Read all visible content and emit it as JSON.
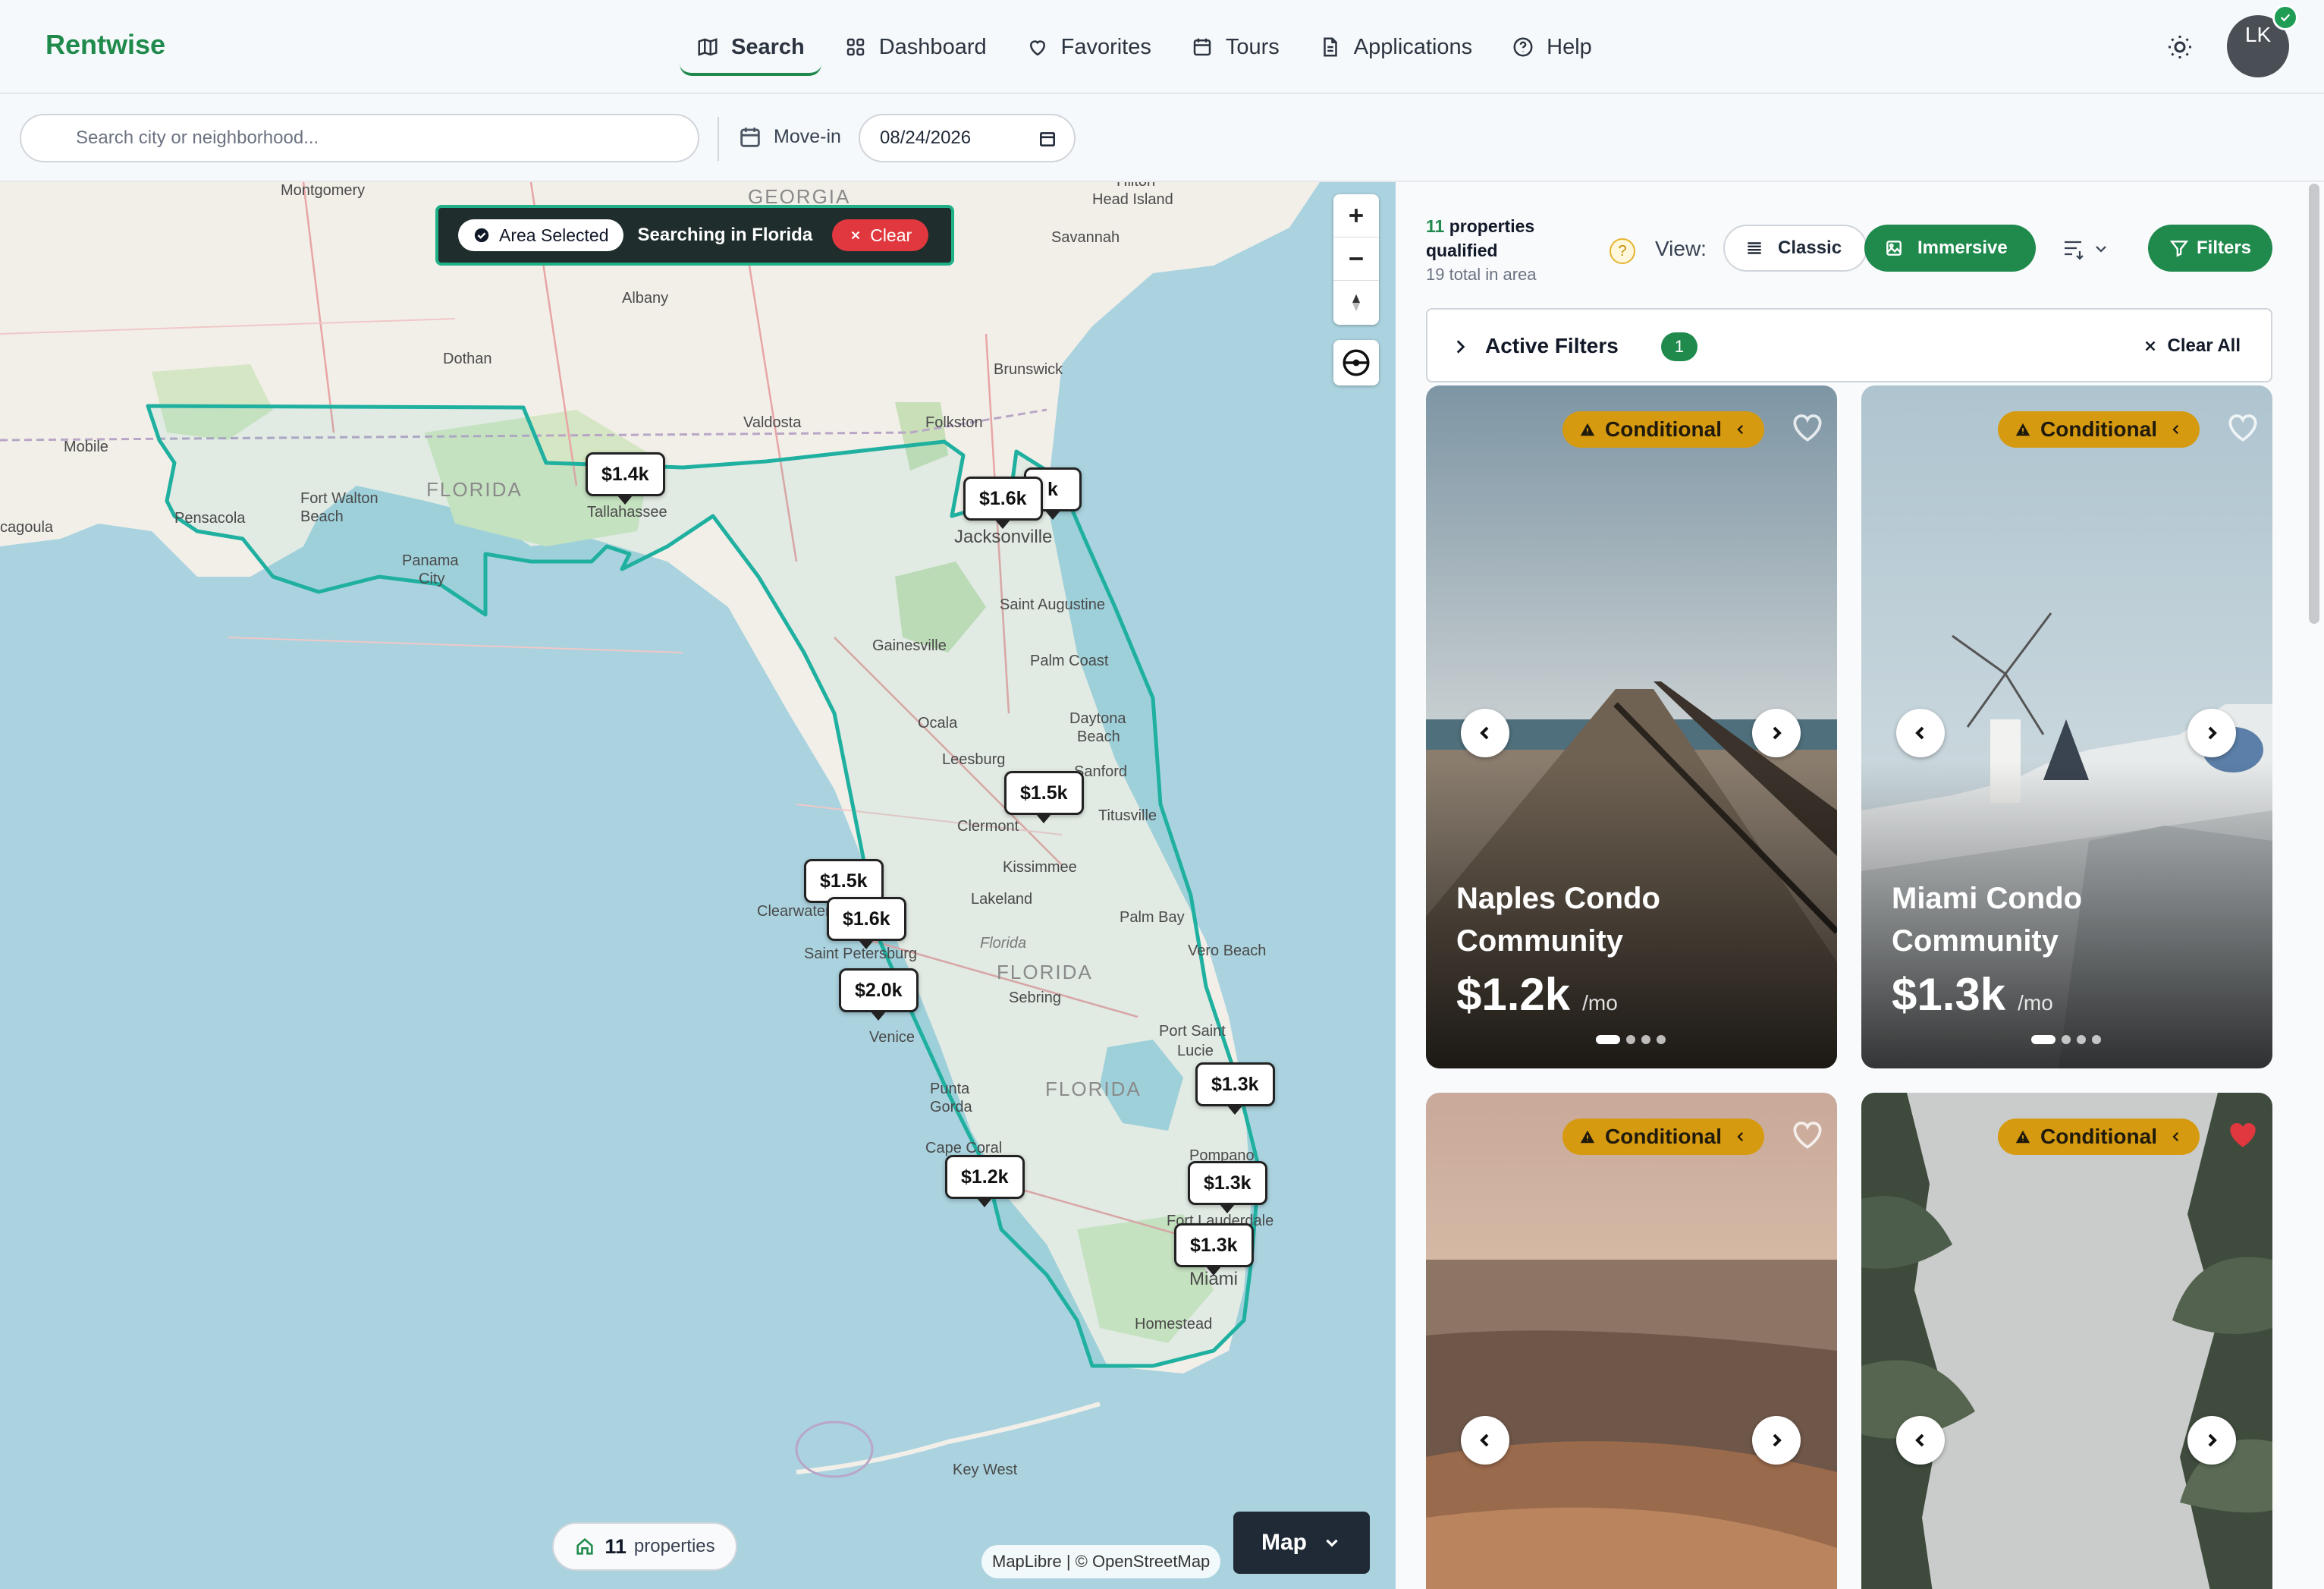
{
  "brand": "Rentwise",
  "nav": {
    "items": [
      {
        "label": "Search",
        "icon": "map-icon",
        "active": true
      },
      {
        "label": "Dashboard",
        "icon": "grid-icon"
      },
      {
        "label": "Favorites",
        "icon": "heart-icon"
      },
      {
        "label": "Tours",
        "icon": "calendar-icon"
      },
      {
        "label": "Applications",
        "icon": "document-icon"
      },
      {
        "label": "Help",
        "icon": "help-circle-icon"
      }
    ]
  },
  "user": {
    "initials": "LK",
    "verified": true
  },
  "search": {
    "placeholder": "Search city or neighborhood...",
    "movein_label": "Move-in",
    "movein_value": "08/24/2026"
  },
  "map": {
    "banner": {
      "chip": "Area Selected",
      "text": "Searching in Florida",
      "clear": "Clear"
    },
    "places": {
      "montgomery": "Montgomery",
      "georgia": "GEORGIA",
      "hilton": "Hilton",
      "head_island": "Head Island",
      "savannah": "Savannah",
      "albany": "Albany",
      "dothan": "Dothan",
      "brunswick": "Brunswick",
      "valdosta": "Valdosta",
      "folkston": "Folkston",
      "mobile": "Mobile",
      "fort_walton": "Fort Walton",
      "beach": "Beach",
      "florida_nw": "FLORIDA",
      "tallahassee": "Tallahassee",
      "jacksonville": "Jacksonville",
      "cagoula": "cagoula",
      "pensacola": "Pensacola",
      "panama": "Panama",
      "city": "City",
      "saint_augustine": "Saint Augustine",
      "gainesville": "Gainesville",
      "palm_coast": "Palm Coast",
      "ocala": "Ocala",
      "daytona": "Daytona",
      "beach2": "Beach",
      "leesburg": "Leesburg",
      "sanford": "Sanford",
      "titusville": "Titusville",
      "clermont": "Clermont",
      "kissimmee": "Kissimmee",
      "clearwater": "Clearwater",
      "lakeland": "Lakeland",
      "palm_bay": "Palm Bay",
      "saint_petersburg": "Saint Petersburg",
      "florida_it": "Florida",
      "florida_c": "FLORIDA",
      "vero_beach": "Vero Beach",
      "sebring": "Sebring",
      "venice": "Venice",
      "port_saint": "Port Saint",
      "lucie": "Lucie",
      "punta": "Punta",
      "gorda": "Gorda",
      "florida_s": "FLORIDA",
      "cape_coral": "Cape Coral",
      "pompano": "Pompano",
      "lauderdale": "Fort Lauderdale",
      "miami": "Miami",
      "homestead": "Homestead",
      "key_west": "Key West"
    },
    "pins": [
      {
        "label": "$1.4k"
      },
      {
        "label": "k"
      },
      {
        "label": "$1.6k"
      },
      {
        "label": "$1.5k"
      },
      {
        "label": "$1.5k"
      },
      {
        "label": "$1.6k"
      },
      {
        "label": "$2.0k"
      },
      {
        "label": "$1.3k"
      },
      {
        "label": "$1.2k"
      },
      {
        "label": "$1.3k"
      },
      {
        "label": "$1.3k"
      }
    ],
    "properties_count": "11",
    "properties_label": "properties",
    "attribution": "MapLibre | © OpenStreetMap",
    "toggle_label": "Map"
  },
  "panel": {
    "qualified_count": "11",
    "qualified_label_1": " properties",
    "qualified_label_2": "qualified",
    "total_label": "19 total in area",
    "help": "?",
    "view_label": "View:",
    "view_classic": "Classic",
    "view_immersive": "Immersive",
    "filters_label": "Filters",
    "active_filters_label": "Active Filters",
    "active_filters_count": "1",
    "clear_all_label": "Clear All",
    "cards": [
      {
        "badge": "Conditional",
        "title": "Naples Condo Community",
        "price": "$1.2k",
        "per": "/mo",
        "favorited": false
      },
      {
        "badge": "Conditional",
        "title": "Miami Condo Community",
        "price": "$1.3k",
        "per": "/mo",
        "favorited": false
      },
      {
        "badge": "Conditional",
        "title": "",
        "price": "",
        "per": "",
        "favorited": false
      },
      {
        "badge": "Conditional",
        "title": "",
        "price": "",
        "per": "",
        "favorited": true
      }
    ]
  },
  "colors": {
    "brand": "#1f8a4c",
    "warning": "#d69a10",
    "danger": "#e0383e",
    "favorite": "#e0383e",
    "map_water": "#aad3df",
    "map_land": "#f2efe9",
    "selection": "#1fb0a0"
  }
}
